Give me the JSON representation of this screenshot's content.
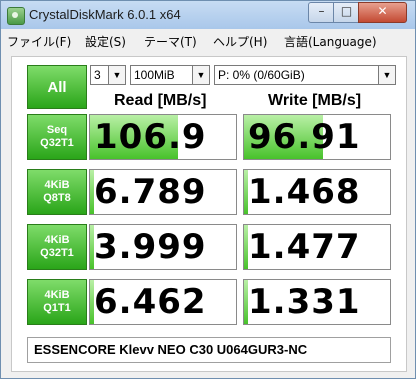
{
  "window": {
    "title": "CrystalDiskMark 6.0.1 x64"
  },
  "menu": [
    "ファイル(F)",
    "設定(S)",
    "テーマ(T)",
    "ヘルプ(H)",
    "言語(Language)"
  ],
  "controls": {
    "all_label": "All",
    "count": "3",
    "size": "100MiB",
    "drive": "P: 0% (0/60GiB)"
  },
  "headers": {
    "read": "Read [MB/s]",
    "write": "Write [MB/s]"
  },
  "tests": [
    {
      "line1": "Seq",
      "line2": "Q32T1",
      "read": "106.9",
      "write": "96.91",
      "read_fill": 0.6,
      "write_fill": 0.54
    },
    {
      "line1": "4KiB",
      "line2": "Q8T8",
      "read": "6.789",
      "write": "1.468",
      "read_fill": 0.03,
      "write_fill": 0.03
    },
    {
      "line1": "4KiB",
      "line2": "Q32T1",
      "read": "3.999",
      "write": "1.477",
      "read_fill": 0.03,
      "write_fill": 0.03
    },
    {
      "line1": "4KiB",
      "line2": "Q1T1",
      "read": "6.462",
      "write": "1.331",
      "read_fill": 0.03,
      "write_fill": 0.03
    }
  ],
  "comment": "ESSENCORE Klevv NEO C30 U064GUR3-NC"
}
